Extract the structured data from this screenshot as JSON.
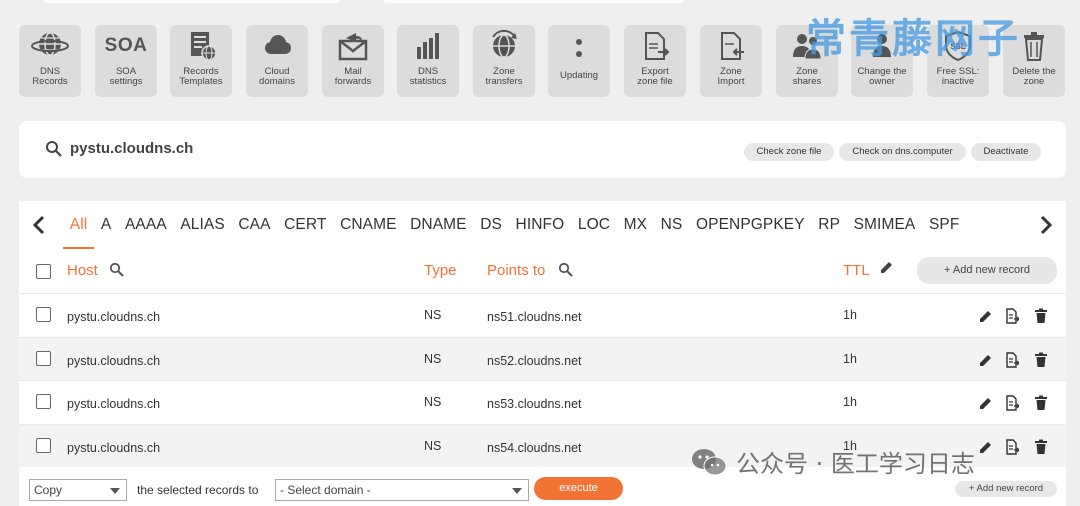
{
  "watermark": "常青藤网子",
  "toolbar": [
    {
      "icon": "globe-dns-icon",
      "label": "DNS\nRecords"
    },
    {
      "icon": "soa-icon",
      "icon_text": "SOA",
      "label": "SOA\nsettings"
    },
    {
      "icon": "records-templates-icon",
      "label": "Records\nTemplates"
    },
    {
      "icon": "cloud-icon",
      "label": "Cloud\ndomains"
    },
    {
      "icon": "mail-forward-icon",
      "label": "Mail\nforwards"
    },
    {
      "icon": "bar-chart-icon",
      "label": "DNS\nstatistics"
    },
    {
      "icon": "zone-transfer-icon",
      "label": "Zone\ntransfers"
    },
    {
      "icon": "updating-dots-icon",
      "label": "Updating"
    },
    {
      "icon": "export-file-icon",
      "label": "Export\nzone file"
    },
    {
      "icon": "import-file-icon",
      "label": "Zone\nImport"
    },
    {
      "icon": "users-icon",
      "label": "Zone\nshares"
    },
    {
      "icon": "change-owner-icon",
      "label": "Change the\nowner"
    },
    {
      "icon": "ssl-shield-icon",
      "icon_text": "SSL",
      "label": "Free SSL:\ninactive"
    },
    {
      "icon": "trash-icon",
      "label": "Delete the\nzone"
    }
  ],
  "domain": {
    "name": "pystu.cloudns.ch",
    "buttons": [
      "Check zone file",
      "Check on dns.computer",
      "Deactivate"
    ]
  },
  "tabs": {
    "active": "All",
    "items": [
      "All",
      "A",
      "AAAA",
      "ALIAS",
      "CAA",
      "CERT",
      "CNAME",
      "DNAME",
      "DS",
      "HINFO",
      "LOC",
      "MX",
      "NS",
      "OPENPGPKEY",
      "RP",
      "SMIMEA",
      "SPF"
    ]
  },
  "table": {
    "columns": {
      "host": "Host",
      "type": "Type",
      "points_to": "Points to",
      "ttl": "TTL"
    },
    "add_record": "+ Add new record",
    "rows": [
      {
        "host": "pystu.cloudns.ch",
        "type": "NS",
        "points_to": "ns51.cloudns.net",
        "ttl": "1h"
      },
      {
        "host": "pystu.cloudns.ch",
        "type": "NS",
        "points_to": "ns52.cloudns.net",
        "ttl": "1h"
      },
      {
        "host": "pystu.cloudns.ch",
        "type": "NS",
        "points_to": "ns53.cloudns.net",
        "ttl": "1h"
      },
      {
        "host": "pystu.cloudns.ch",
        "type": "NS",
        "points_to": "ns54.cloudns.net",
        "ttl": "1h"
      }
    ]
  },
  "bottom": {
    "action_select": "Copy",
    "label": "the selected records to",
    "domain_select": "- Select domain -",
    "execute": "execute",
    "add_record": "+ Add new record"
  },
  "overlay": {
    "wechat_text": "公众号 · 医工学习日志"
  },
  "colors": {
    "accent": "#f27434",
    "tile": "#dcdcdc",
    "watermark": "#489be2"
  }
}
